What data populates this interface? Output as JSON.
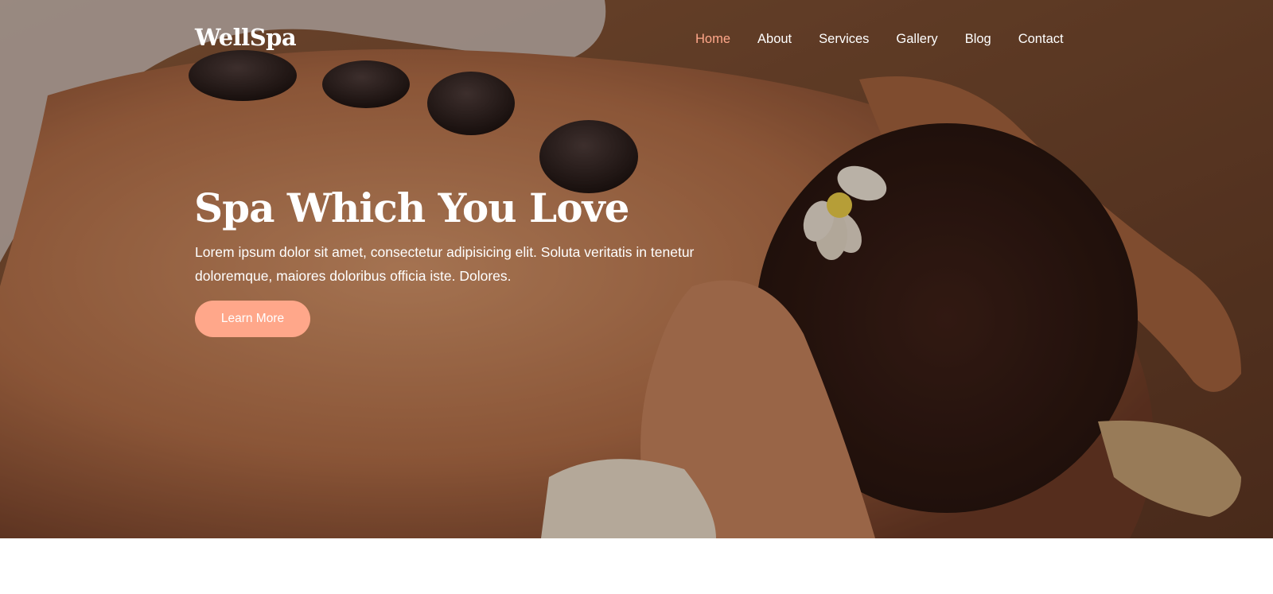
{
  "brand": {
    "name": "WellSpa"
  },
  "nav": {
    "items": [
      {
        "label": "Home",
        "active": true
      },
      {
        "label": "About",
        "active": false
      },
      {
        "label": "Services",
        "active": false
      },
      {
        "label": "Gallery",
        "active": false
      },
      {
        "label": "Blog",
        "active": false
      },
      {
        "label": "Contact",
        "active": false
      }
    ]
  },
  "hero": {
    "headline": "Spa Which You Love",
    "lead": "Lorem ipsum dolor sit amet, consectetur adipisicing elit. Soluta veritatis in tenetur doloremque, maiores doloribus officia iste. Dolores.",
    "cta_label": "Learn More",
    "image_subject": "spa-massage-hot-stones-photo"
  },
  "colors": {
    "accent": "#ffa78a",
    "text_on_hero": "#ffffff",
    "page_background": "#ffffff"
  }
}
